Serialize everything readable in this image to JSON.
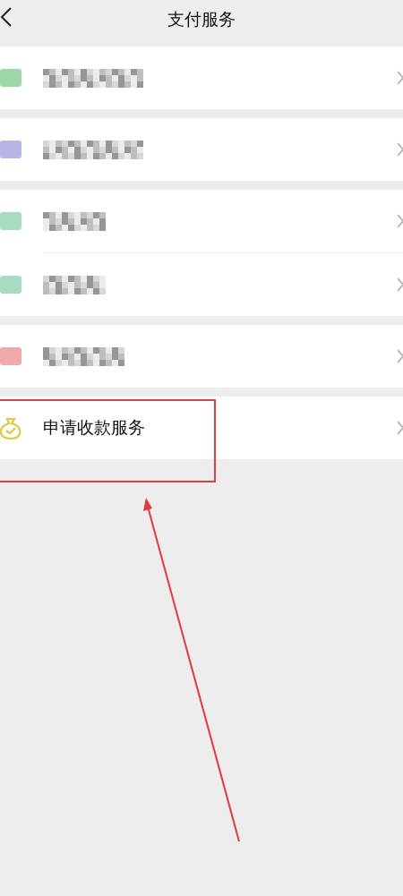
{
  "header": {
    "title": "支付服务"
  },
  "groups": [
    {
      "items": [
        {
          "kind": "redacted",
          "color": "#9fd8a8",
          "highlighted": false
        }
      ]
    },
    {
      "items": [
        {
          "kind": "redacted",
          "color": "#b8b4e4",
          "highlighted": false
        }
      ]
    },
    {
      "items": [
        {
          "kind": "redacted",
          "color": "#a8dcc0",
          "highlighted": false
        },
        {
          "kind": "redacted",
          "color": "#a8dcc0",
          "highlighted": false
        }
      ]
    },
    {
      "items": [
        {
          "kind": "redacted",
          "color": "#f0a8a8",
          "highlighted": false
        }
      ]
    },
    {
      "items": [
        {
          "kind": "label",
          "label": "申请收款服务",
          "color": "#e0c840",
          "highlighted": true
        }
      ]
    }
  ]
}
